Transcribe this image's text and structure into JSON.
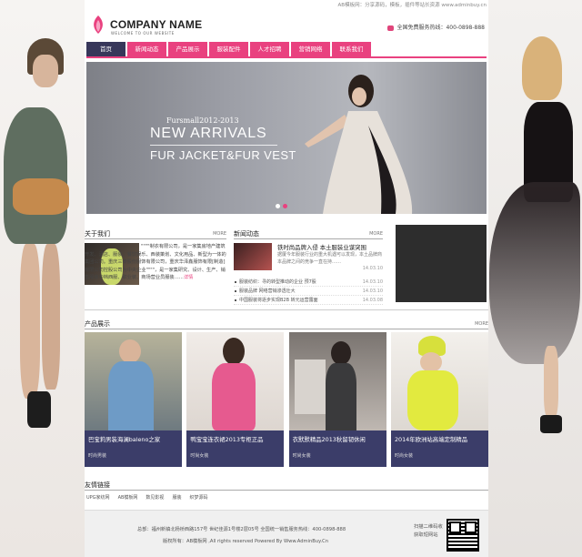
{
  "topbar": {
    "text": "AB模板网：分享源码，模板，插件等站长资源 www.adminbuy.cn"
  },
  "logo": {
    "name": "COMPANY NAME",
    "sub": "WELCOME TO OUR WEBSITE"
  },
  "hotline": {
    "label": "全国免费服务热线：400-0898-888"
  },
  "nav": [
    {
      "label": "首页"
    },
    {
      "label": "新闻动态"
    },
    {
      "label": "产品展示"
    },
    {
      "label": "服装配件"
    },
    {
      "label": "人才招聘"
    },
    {
      "label": "营销网络"
    },
    {
      "label": "联系我们"
    }
  ],
  "banner": {
    "sub": "Fursmall2012-2013",
    "title": "NEW ARRIVALS",
    "title2": "FUR JACKET&FUR VEST"
  },
  "about": {
    "title": "关于我们",
    "more": "MORE",
    "text": "\"\"\"\"制衣有限公司，是一家集房地产建筑开发、酒店、服装、餐饮娱乐、西装策划、文化用品、新型为一体的集团公司。重庆三泰股份服饰有限公司，重庆华泽鑫服饰有限[制造]有限公司控股公司为中央企业\"\"\"\"，是一家集研究、设计、生产、销售服装中档西服、职业装、商场营业员服装……",
    "link": "详情"
  },
  "news": {
    "title": "新闻动态",
    "more": "MORE",
    "lead": "铁时尚品牌入侵 本土服装业谋突围",
    "lead_desc": "据厦今年服装行业的重大机遇可以发现，本土品牌商本品牌之间的竞争一直在持……",
    "lead_date": "14.03.10",
    "items": [
      {
        "title": "服装纺织：寻的转型推动的企业 预7股",
        "date": "14.03.10"
      },
      {
        "title": "服装品牌 网络营销渗透壮大",
        "date": "14.03.10"
      },
      {
        "title": "中国服装将逐步实现B2B 转元运营露面",
        "date": "14.03.08"
      }
    ]
  },
  "products": {
    "title": "产品展示",
    "more": "MORE",
    "items": [
      {
        "name": "巴宝莉男装海澜baleno之家",
        "cat": "时尚男装"
      },
      {
        "name": "鸭宝宝连衣裙2013专柜正品",
        "cat": "时尚女装"
      },
      {
        "name": "衣默默精品2013秋留韧休闲",
        "cat": "时尚女装"
      },
      {
        "name": "2014年欧洲站高端定制精品",
        "cat": "时尚女装"
      }
    ]
  },
  "links": {
    "title": "友情链接",
    "items": [
      "UPG家纺网",
      "AB模板网",
      "数见影视",
      "服装",
      "织梦源码"
    ]
  },
  "footer": {
    "line1": "总部：福州新镇北杨桥西路157号 世纪佳源1号楼2层05号   全国统一销售服务热线：400-0898-888",
    "line2": "版权所有：AB模板网 ,All rights reserved Powered By Www.AdminBuy.Cn",
    "qr1": "扫描二维码收",
    "qr2": "获取短网站"
  },
  "colors": {
    "accent": "#e9417f",
    "nav_active": "#37375a",
    "caption_bg": "#3b3d69"
  }
}
